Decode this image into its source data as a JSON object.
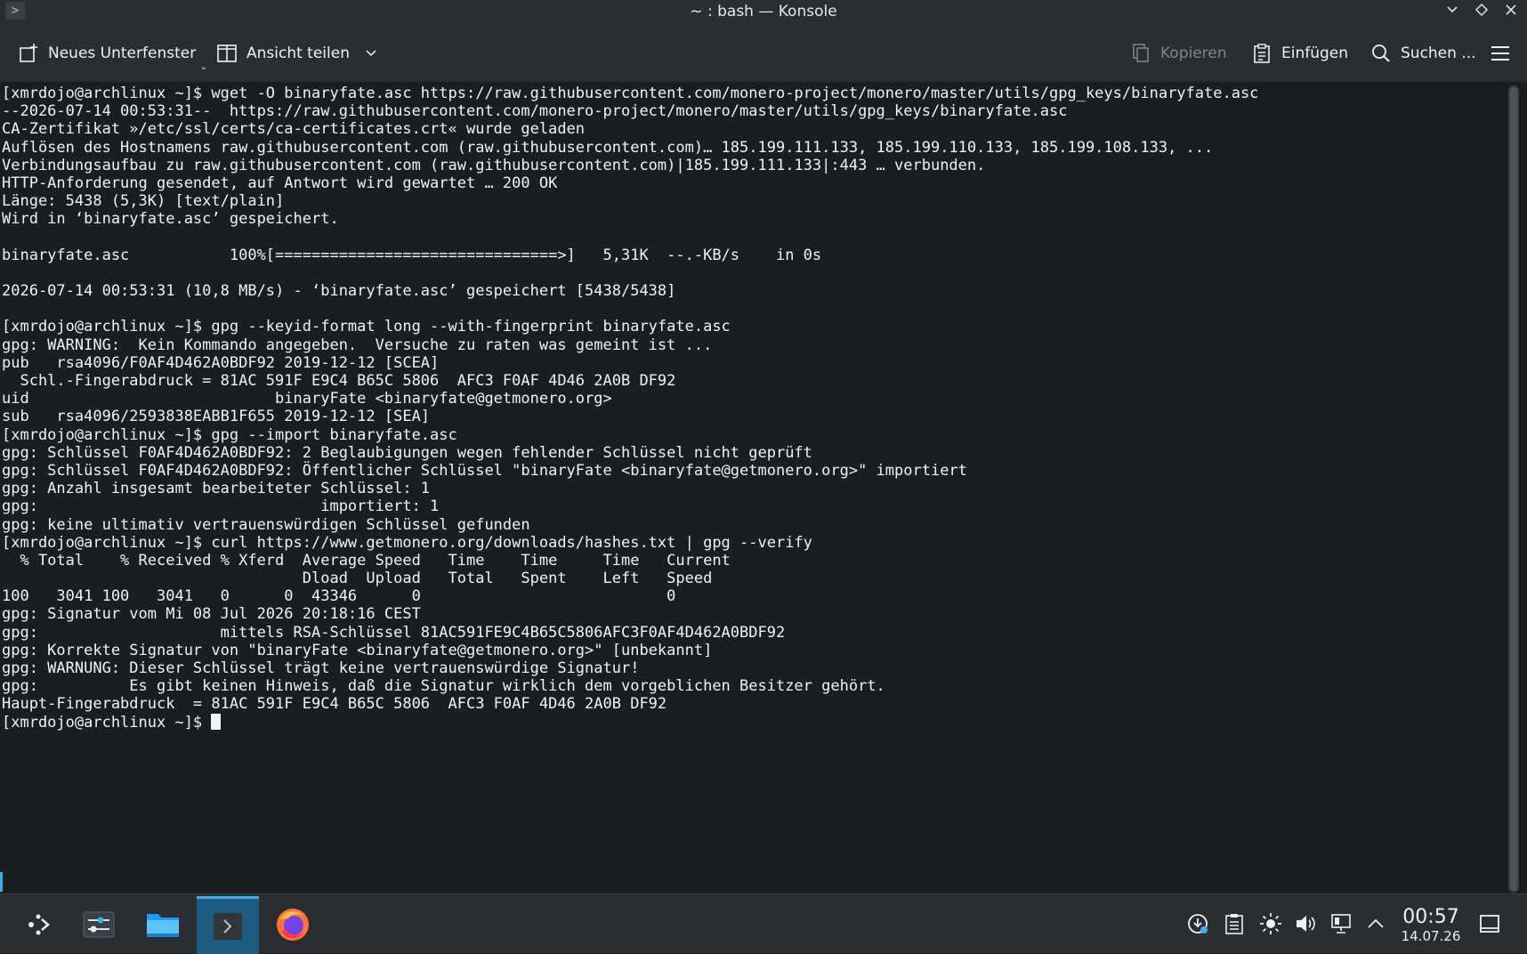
{
  "window": {
    "title": "~ : bash — Konsole",
    "app_icon": ">",
    "controls": [
      "minimize-icon",
      "maximize-icon",
      "close-icon"
    ]
  },
  "toolbar": {
    "new_tab_label": "Neues Unterfenster",
    "split_view_label": "Ansicht teilen",
    "copy_label": "Kopieren",
    "paste_label": "Einfügen",
    "search_label": "Suchen ..."
  },
  "terminal": {
    "lines": [
      "[xmrdojo@archlinux ~]$ wget -O binaryfate.asc https://raw.githubusercontent.com/monero-project/monero/master/utils/gpg_keys/binaryfate.asc",
      "--2026-07-14 00:53:31--  https://raw.githubusercontent.com/monero-project/monero/master/utils/gpg_keys/binaryfate.asc",
      "CA-Zertifikat »/etc/ssl/certs/ca-certificates.crt« wurde geladen",
      "Auflösen des Hostnamens raw.githubusercontent.com (raw.githubusercontent.com)… 185.199.111.133, 185.199.110.133, 185.199.108.133, ...",
      "Verbindungsaufbau zu raw.githubusercontent.com (raw.githubusercontent.com)|185.199.111.133|:443 … verbunden.",
      "HTTP-Anforderung gesendet, auf Antwort wird gewartet … 200 OK",
      "Länge: 5438 (5,3K) [text/plain]",
      "Wird in ‘binaryfate.asc’ gespeichert.",
      "",
      "binaryfate.asc           100%[===============================>]   5,31K  --.-KB/s    in 0s",
      "",
      "2026-07-14 00:53:31 (10,8 MB/s) - ‘binaryfate.asc’ gespeichert [5438/5438]",
      "",
      "[xmrdojo@archlinux ~]$ gpg --keyid-format long --with-fingerprint binaryfate.asc",
      "gpg: WARNING:  Kein Kommando angegeben.  Versuche zu raten was gemeint ist ...",
      "pub   rsa4096/F0AF4D462A0BDF92 2019-12-12 [SCEA]",
      "  Schl.-Fingerabdruck = 81AC 591F E9C4 B65C 5806  AFC3 F0AF 4D46 2A0B DF92",
      "uid                           binaryFate <binaryfate@getmonero.org>",
      "sub   rsa4096/2593838EABB1F655 2019-12-12 [SEA]",
      "[xmrdojo@archlinux ~]$ gpg --import binaryfate.asc",
      "gpg: Schlüssel F0AF4D462A0BDF92: 2 Beglaubigungen wegen fehlender Schlüssel nicht geprüft",
      "gpg: Schlüssel F0AF4D462A0BDF92: Öffentlicher Schlüssel \"binaryFate <binaryfate@getmonero.org>\" importiert",
      "gpg: Anzahl insgesamt bearbeiteter Schlüssel: 1",
      "gpg:                               importiert: 1",
      "gpg: keine ultimativ vertrauenswürdigen Schlüssel gefunden",
      "[xmrdojo@archlinux ~]$ curl https://www.getmonero.org/downloads/hashes.txt | gpg --verify",
      "  % Total    % Received % Xferd  Average Speed   Time    Time     Time   Current",
      "                                 Dload  Upload   Total   Spent    Left   Speed",
      "100   3041 100   3041   0      0  43346      0                           0",
      "gpg: Signatur vom Mi 08 Jul 2026 20:18:16 CEST",
      "gpg:                    mittels RSA-Schlüssel 81AC591FE9C4B65C5806AFC3F0AF4D462A0BDF92",
      "gpg: Korrekte Signatur von \"binaryFate <binaryfate@getmonero.org>\" [unbekannt]",
      "gpg: WARNUNG: Dieser Schlüssel trägt keine vertrauenswürdige Signatur!",
      "gpg:          Es gibt keinen Hinweis, daß die Signatur wirklich dem vorgeblichen Besitzer gehört.",
      "Haupt-Fingerabdruck  = 81AC 591F E9C4 B65C 5806  AFC3 F0AF 4D46 2A0B DF92"
    ],
    "prompt": "[xmrdojo@archlinux ~]$ "
  },
  "taskbar": {
    "launcher_icon": "application-launcher-icon",
    "tasks": [
      {
        "icon": "system-settings-icon"
      },
      {
        "icon": "file-manager-icon"
      },
      {
        "icon": "terminal-icon",
        "active": true
      },
      {
        "icon": "firefox-icon"
      }
    ],
    "tray": [
      "update-icon",
      "clipboard-icon",
      "brightness-icon",
      "volume-icon",
      "network-icon",
      "tray-expand-icon"
    ],
    "clock_time": "00:57",
    "clock_date": "14.07.26",
    "show_desktop_icon": "show-desktop-icon"
  },
  "colors": {
    "background": "#1b1e20",
    "panel": "#2a2e32",
    "accent": "#3daee9",
    "text": "#f2f2f2"
  }
}
